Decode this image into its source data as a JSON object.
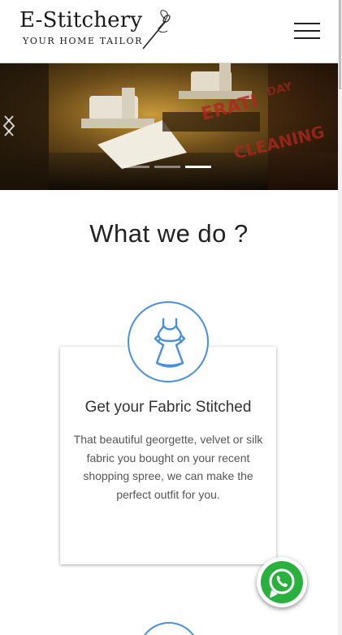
{
  "header": {
    "logo_title": "E-Stitchery",
    "logo_tagline": "YOUR HOME TAILOR",
    "menu_icon": "hamburger-menu-icon"
  },
  "hero": {
    "slide_count": 3,
    "active_slide": 3,
    "prev_icon": "chevron-left-icon",
    "next_icon": "chevron-right-icon"
  },
  "section": {
    "title": "What we do ?"
  },
  "card": {
    "icon": "dress-icon",
    "title": "Get your Fabric Stitched",
    "text": "That beautiful georgette, velvet or silk fabric you bought on your recent shopping spree, we can make the perfect outfit for you."
  },
  "whatsapp": {
    "icon": "whatsapp-icon"
  },
  "colors": {
    "accent": "#4a90d9",
    "whatsapp": "#2ab03c"
  }
}
